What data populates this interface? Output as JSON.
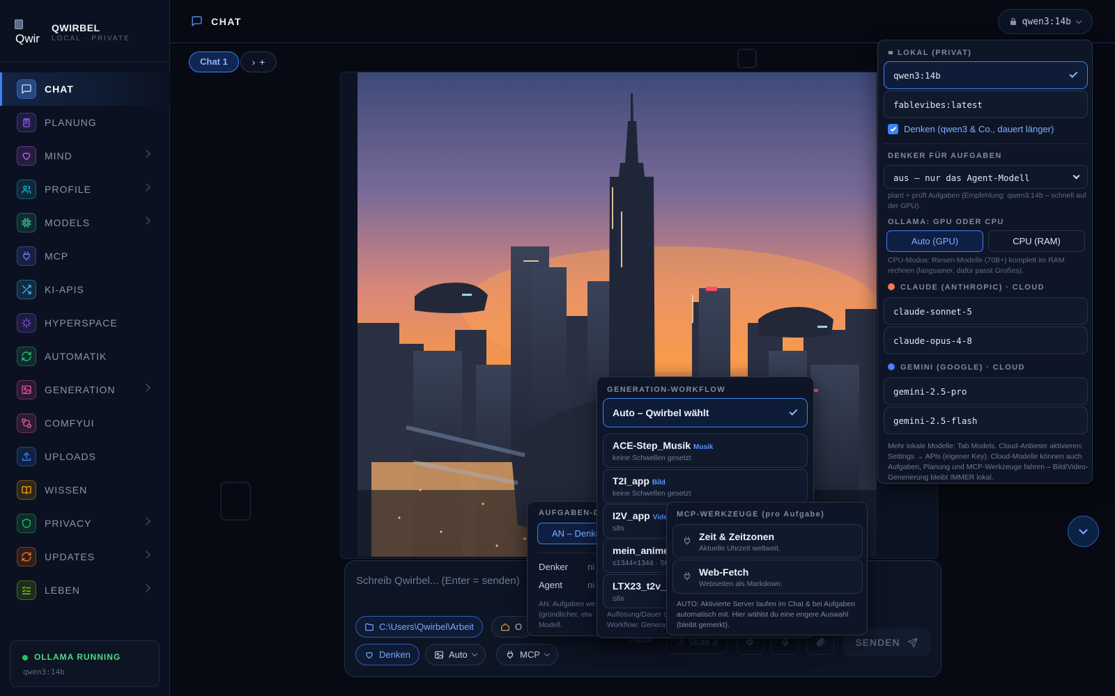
{
  "app": {
    "logo_text": "Qwir",
    "name": "QWIRBEL",
    "tagline": "LOCAL · PRIVATE"
  },
  "sidebar": {
    "items": [
      {
        "label": "CHAT",
        "icon": "chat-icon",
        "color": "#4f8ff7",
        "active": true,
        "chevron": false
      },
      {
        "label": "PLANUNG",
        "icon": "clipboard-icon",
        "color": "#8b5cf6",
        "chevron": false
      },
      {
        "label": "MIND",
        "icon": "heart-icon",
        "color": "#c05cf6",
        "chevron": true
      },
      {
        "label": "PROFILE",
        "icon": "users-icon",
        "color": "#22b8cf",
        "chevron": true
      },
      {
        "label": "MODELS",
        "icon": "cpu-icon",
        "color": "#2fbf8f",
        "chevron": true
      },
      {
        "label": "MCP",
        "icon": "plug-icon",
        "color": "#6b7cf7",
        "chevron": false
      },
      {
        "label": "KI-APIS",
        "icon": "shuffle-icon",
        "color": "#38bdf8",
        "chevron": false
      },
      {
        "label": "HYPERSPACE",
        "icon": "sparkle-icon",
        "color": "#8b5cf6",
        "chevron": false
      },
      {
        "label": "AUTOMATIK",
        "icon": "refresh-icon",
        "color": "#2fbf7a",
        "chevron": false
      },
      {
        "label": "GENERATION",
        "icon": "image-icon",
        "color": "#e0529c",
        "chevron": true
      },
      {
        "label": "COMFYUI",
        "icon": "workflow-icon",
        "color": "#e05c9c",
        "chevron": false
      },
      {
        "label": "UPLOADS",
        "icon": "upload-icon",
        "color": "#3b82f6",
        "chevron": false
      },
      {
        "label": "WISSEN",
        "icon": "book-icon",
        "color": "#f59e0b",
        "chevron": false
      },
      {
        "label": "PRIVACY",
        "icon": "shield-icon",
        "color": "#22c55e",
        "chevron": true
      },
      {
        "label": "UPDATES",
        "icon": "update-icon",
        "color": "#f97316",
        "chevron": true
      },
      {
        "label": "LEBEN",
        "icon": "list-check-icon",
        "color": "#84cc16",
        "chevron": true
      }
    ]
  },
  "status": {
    "label": "OLLAMA RUNNING",
    "model": "qwen3:14b"
  },
  "header": {
    "title": "CHAT",
    "model": "qwen3:14b"
  },
  "chat": {
    "tabs": [
      {
        "label": "Chat 1"
      }
    ]
  },
  "composer": {
    "placeholder": "Schreib Qwirbel... (Enter = senden)",
    "path": "C:\\Users\\Qwirbel\\Arbeit",
    "home_label": "O",
    "think": "Denken",
    "auto": "Auto",
    "mcp": "MCP",
    "count": "179/33k",
    "stufe": "Stufe 3",
    "send": "SENDEN"
  },
  "gen_panel": {
    "title": "GENERATION-WORKFLOW",
    "options": [
      {
        "name": "Auto – Qwirbel wählt",
        "tag": "",
        "sub": "",
        "selected": true
      },
      {
        "name": "ACE-Step_Musik",
        "tag": "Musik",
        "sub": "keine Schwellen gesetzt"
      },
      {
        "name": "T2I_app",
        "tag": "Bild",
        "sub": "keine Schwellen gesetzt"
      },
      {
        "name": "I2V_app",
        "tag": "Vide",
        "sub": "≤8s"
      },
      {
        "name": "mein_anime_",
        "tag": "",
        "sub": "≤1344×1344 · St"
      },
      {
        "name": "LTX23_t2v_a",
        "tag": "",
        "sub": "≤6s"
      }
    ],
    "footer": "Auflösung/Dauer c\nWorkflow: Genera"
  },
  "auf_panel": {
    "title": "AUFGABEN-DI",
    "toggle": "AN – Denke",
    "rows": [
      {
        "label": "Denker",
        "value": "ni"
      },
      {
        "label": "Agent",
        "value": "ni"
      }
    ],
    "note": "AN: Aufgaben we\n(gründlicher, etw\nModell."
  },
  "mcp_panel": {
    "title": "MCP-WERKZEUGE (pro Aufgabe)",
    "tools": [
      {
        "name": "Zeit & Zeitzonen",
        "desc": "Aktuelle Uhrzeit weltweit."
      },
      {
        "name": "Web-Fetch",
        "desc": "Webseiten als Markdown."
      }
    ],
    "note": "AUTO: Aktivierte Server laufen im Chat & bei Aufgaben automatisch mit. Hier wählst du eine engere Auswahl (bleibt gemerkt)."
  },
  "model_panel": {
    "local_title": "LOKAL (PRIVAT)",
    "local_models": [
      {
        "name": "qwen3:14b",
        "selected": true
      },
      {
        "name": "fablevibes:latest"
      }
    ],
    "think_label": "Denken (qwen3 & Co., dauert länger)",
    "think_checked": true,
    "denker_title": "DENKER FÜR AUFGABEN",
    "denker_value": "aus – nur das Agent-Modell",
    "denker_hint": "plant + prüft Aufgaben (Empfehlung: qwen3:14b – schnell auf der GPU).",
    "ollama_title": "OLLAMA: GPU ODER CPU",
    "gpu_auto": "Auto (GPU)",
    "gpu_cpu": "CPU (RAM)",
    "cpu_hint": "CPU-Modus: Riesen-Modelle (70B+) komplett im RAM rechnen (langsamer, dafür passt Großes).",
    "claude_title": "CLAUDE (ANTHROPIC) · CLOUD",
    "claude_color": "#f07a4a",
    "claude_models": [
      "claude-sonnet-5",
      "claude-opus-4-8"
    ],
    "gemini_title": "GEMINI (GOOGLE) · CLOUD",
    "gemini_color": "#4f7bff",
    "gemini_models": [
      "gemini-2.5-pro",
      "gemini-2.5-flash"
    ],
    "footer": "Mehr lokale Modelle: Tab Models. Cloud-Anbieter aktivieren: Settings → APIs (eigener Key). Cloud-Modelle können auch Aufgaben, Planung und MCP-Werkzeuge fahren – Bild/Video-Generierung bleibt IMMER lokal."
  },
  "colors": {
    "accent": "#3b82f6",
    "bg": "#070a12",
    "panel": "#0e1526",
    "success": "#22c55e"
  }
}
